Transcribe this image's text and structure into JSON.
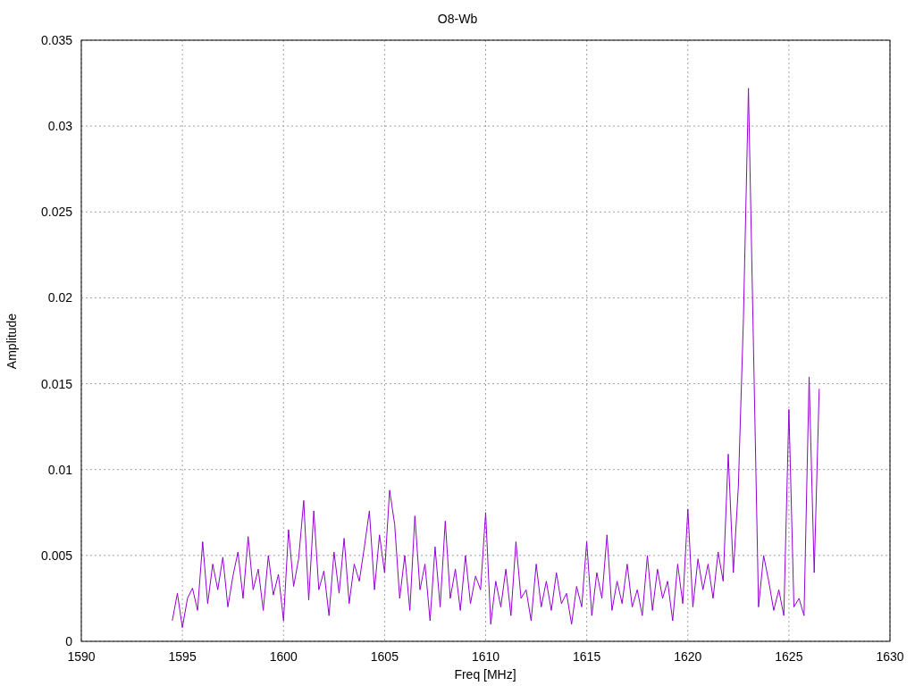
{
  "chart_data": {
    "type": "line",
    "title": "O8-Wb",
    "xlabel": "Freq [MHz]",
    "ylabel": "Amplitude",
    "grid": true,
    "xlim": [
      1590,
      1630
    ],
    "ylim": [
      0,
      0.035
    ],
    "xticks": [
      1590,
      1595,
      1600,
      1605,
      1610,
      1615,
      1620,
      1625,
      1630
    ],
    "yticks": [
      0,
      0.005,
      0.01,
      0.015,
      0.02,
      0.025,
      0.03,
      0.035
    ],
    "x": [
      1594.5,
      1594.75,
      1595,
      1595.25,
      1595.5,
      1595.75,
      1596,
      1596.25,
      1596.5,
      1596.75,
      1597,
      1597.25,
      1597.5,
      1597.75,
      1598,
      1598.25,
      1598.5,
      1598.75,
      1599,
      1599.25,
      1599.5,
      1599.75,
      1600,
      1600.25,
      1600.5,
      1600.75,
      1601,
      1601.25,
      1601.5,
      1601.75,
      1602,
      1602.25,
      1602.5,
      1602.75,
      1603,
      1603.25,
      1603.5,
      1603.75,
      1604,
      1604.25,
      1604.5,
      1604.75,
      1605,
      1605.25,
      1605.5,
      1605.75,
      1606,
      1606.25,
      1606.5,
      1606.75,
      1607,
      1607.25,
      1607.5,
      1607.75,
      1608,
      1608.25,
      1608.5,
      1608.75,
      1609,
      1609.25,
      1609.5,
      1609.75,
      1610,
      1610.25,
      1610.5,
      1610.75,
      1611,
      1611.25,
      1611.5,
      1611.75,
      1612,
      1612.25,
      1612.5,
      1612.75,
      1613,
      1613.25,
      1613.5,
      1613.75,
      1614,
      1614.25,
      1614.5,
      1614.75,
      1615,
      1615.25,
      1615.5,
      1615.75,
      1616,
      1616.25,
      1616.5,
      1616.75,
      1617,
      1617.25,
      1617.5,
      1617.75,
      1618,
      1618.25,
      1618.5,
      1618.75,
      1619,
      1619.25,
      1619.5,
      1619.75,
      1620,
      1620.25,
      1620.5,
      1620.75,
      1621,
      1621.25,
      1621.5,
      1621.75,
      1622,
      1622.25,
      1622.5,
      1622.75,
      1623,
      1623.25,
      1623.5,
      1623.75,
      1624,
      1624.25,
      1624.5,
      1624.75,
      1625,
      1625.25,
      1625.5,
      1625.75,
      1626,
      1626.25,
      1626.5
    ],
    "series": [
      {
        "color": "#9400d3",
        "values": [
          0.0012,
          0.0028,
          0.0008,
          0.0025,
          0.0031,
          0.0018,
          0.0058,
          0.0022,
          0.0045,
          0.003,
          0.0049,
          0.002,
          0.0038,
          0.0052,
          0.0025,
          0.0061,
          0.003,
          0.0042,
          0.0018,
          0.005,
          0.0027,
          0.0039,
          0.0012,
          0.0065,
          0.0032,
          0.0048,
          0.0082,
          0.0024,
          0.0076,
          0.003,
          0.0041,
          0.0015,
          0.0052,
          0.0028,
          0.006,
          0.0022,
          0.0045,
          0.0035,
          0.0055,
          0.0076,
          0.003,
          0.0062,
          0.004,
          0.0088,
          0.0068,
          0.0025,
          0.005,
          0.0018,
          0.0073,
          0.003,
          0.0045,
          0.0012,
          0.0055,
          0.002,
          0.007,
          0.0025,
          0.0042,
          0.0018,
          0.005,
          0.0022,
          0.0038,
          0.003,
          0.0075,
          0.001,
          0.0035,
          0.002,
          0.0042,
          0.0015,
          0.0058,
          0.0025,
          0.003,
          0.0012,
          0.0045,
          0.002,
          0.0035,
          0.0018,
          0.004,
          0.0022,
          0.0028,
          0.001,
          0.0032,
          0.002,
          0.0058,
          0.0015,
          0.004,
          0.0025,
          0.0062,
          0.0018,
          0.0035,
          0.0022,
          0.0045,
          0.002,
          0.003,
          0.0015,
          0.005,
          0.0018,
          0.0042,
          0.0025,
          0.0035,
          0.0012,
          0.0045,
          0.0022,
          0.0077,
          0.002,
          0.0048,
          0.003,
          0.0045,
          0.0025,
          0.0052,
          0.0035,
          0.0109,
          0.004,
          0.009,
          0.0188,
          0.0322,
          0.017,
          0.002,
          0.005,
          0.0035,
          0.0018,
          0.003,
          0.0015,
          0.0135,
          0.002,
          0.0025,
          0.0015,
          0.0154,
          0.004,
          0.0147
        ]
      }
    ]
  }
}
